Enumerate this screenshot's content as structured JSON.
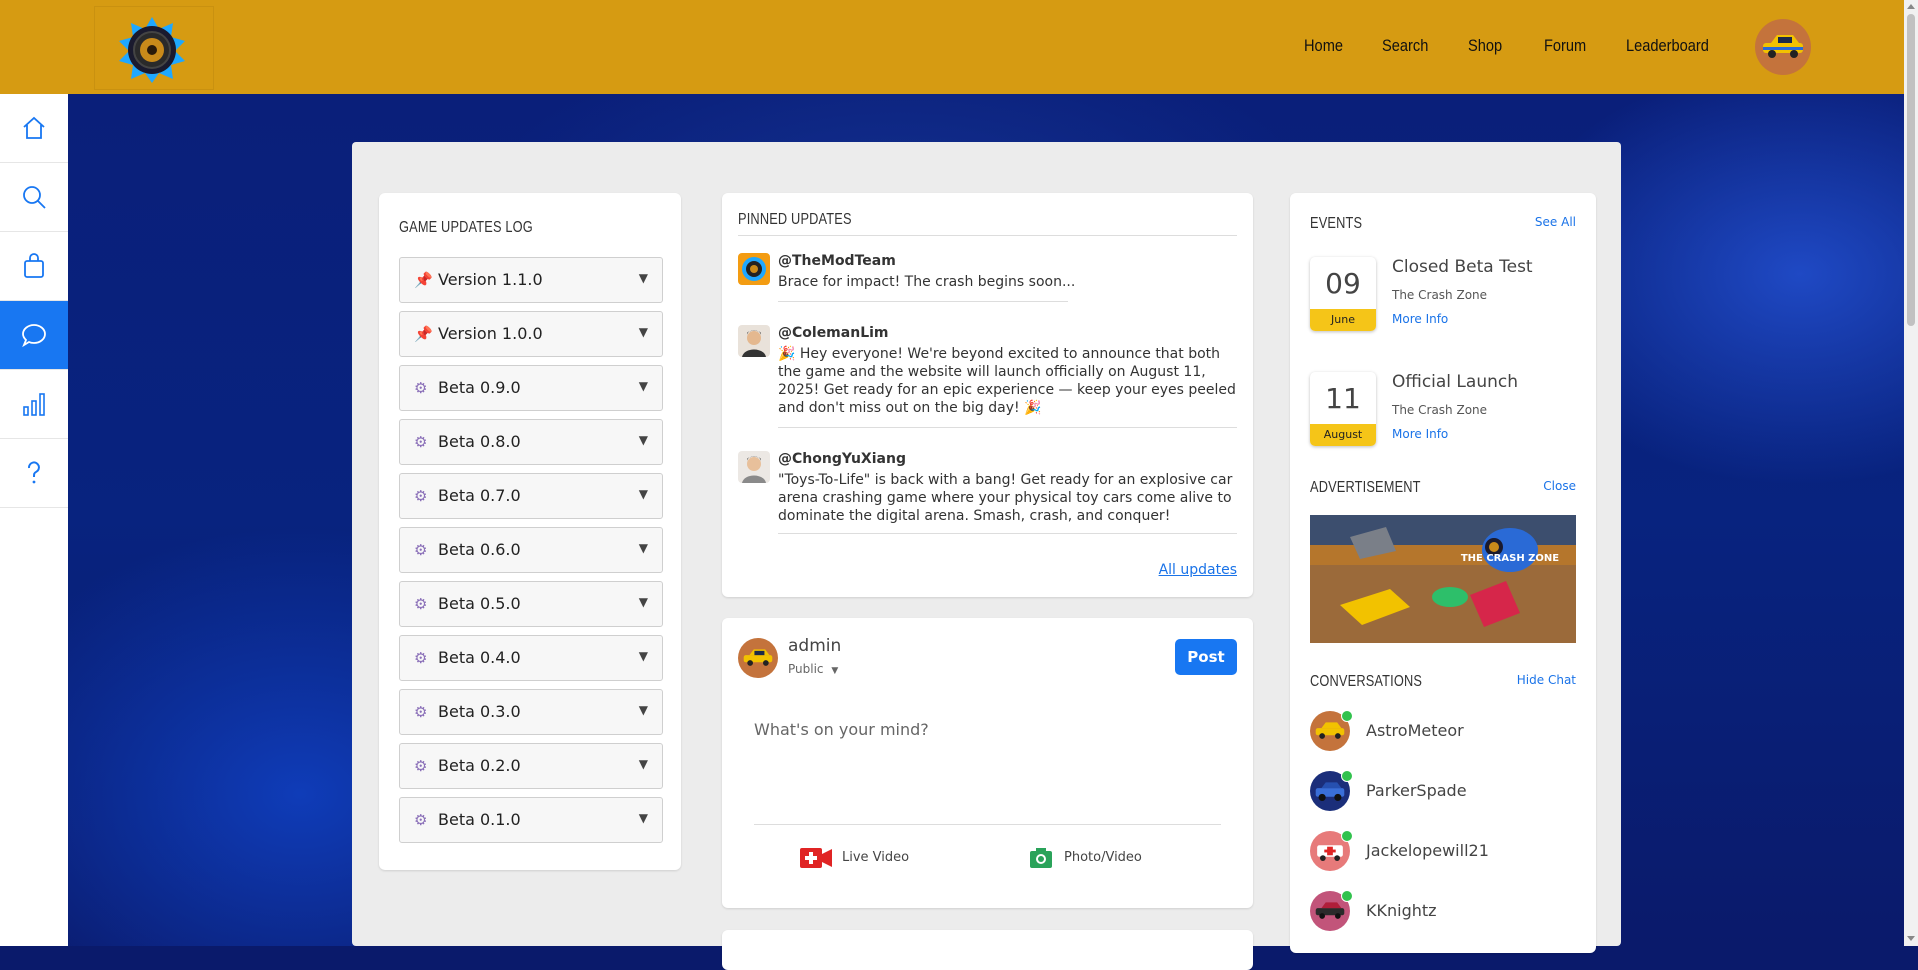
{
  "header": {
    "nav": [
      "Home",
      "Search",
      "Shop",
      "Forum",
      "Leaderboard"
    ]
  },
  "sidebar": {
    "items": [
      "home-icon",
      "search-icon",
      "bag-icon",
      "chat-icon",
      "chart-icon",
      "help-icon"
    ],
    "active": "chat-icon"
  },
  "updates_log": {
    "title": "GAME UPDATES LOG",
    "versions": [
      {
        "label": "Version 1.1.0",
        "icon": "pin"
      },
      {
        "label": "Version 1.0.0",
        "icon": "pin"
      },
      {
        "label": "Beta 0.9.0",
        "icon": "gear"
      },
      {
        "label": "Beta 0.8.0",
        "icon": "gear"
      },
      {
        "label": "Beta 0.7.0",
        "icon": "gear"
      },
      {
        "label": "Beta 0.6.0",
        "icon": "gear"
      },
      {
        "label": "Beta 0.5.0",
        "icon": "gear"
      },
      {
        "label": "Beta 0.4.0",
        "icon": "gear"
      },
      {
        "label": "Beta 0.3.0",
        "icon": "gear"
      },
      {
        "label": "Beta 0.2.0",
        "icon": "gear"
      },
      {
        "label": "Beta 0.1.0",
        "icon": "gear"
      }
    ]
  },
  "pinned": {
    "title": "PINNED UPDATES",
    "posts": [
      {
        "user": "@TheModTeam",
        "text": "Brace for impact! The crash begins soon..."
      },
      {
        "user": "@ColemanLim",
        "text": "🎉 Hey everyone! We're beyond excited to announce that both the game and the website will launch officially on August 11, 2025! Get ready for an epic experience — keep your eyes peeled and don't miss out on the big day! 🎉"
      },
      {
        "user": "@ChongYuXiang",
        "text": "\"Toys-To-Life\" is back with a bang! Get ready for an explosive car arena crashing game where your physical toy cars come alive to dominate the digital arena. Smash, crash, and conquer!"
      }
    ],
    "all_updates": "All updates"
  },
  "composer": {
    "user": "admin",
    "visibility": "Public",
    "post_label": "Post",
    "placeholder": "What's on your mind?",
    "live_video": "Live Video",
    "photo_video": "Photo/Video"
  },
  "events": {
    "title": "EVENTS",
    "see_all": "See All",
    "items": [
      {
        "day": "09",
        "month": "June",
        "title": "Closed Beta Test",
        "subtitle": "The Crash Zone",
        "more": "More Info"
      },
      {
        "day": "11",
        "month": "August",
        "title": "Official Launch",
        "subtitle": "The Crash Zone",
        "more": "More Info"
      }
    ]
  },
  "advertisement": {
    "title": "ADVERTISEMENT",
    "close": "Close",
    "banner_text": "THE CRASH ZONE"
  },
  "conversations": {
    "title": "CONVERSATIONS",
    "hide": "Hide Chat",
    "users": [
      "AstroMeteor",
      "ParkerSpade",
      "Jackelopewill21",
      "KKnightz"
    ]
  }
}
